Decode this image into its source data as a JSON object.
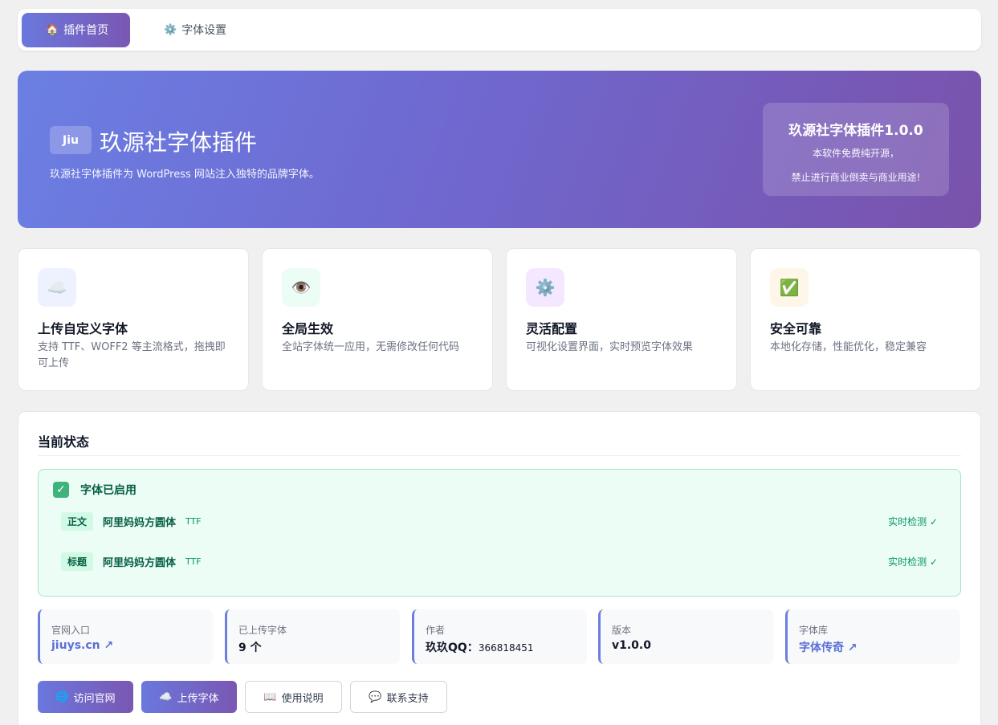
{
  "tabs": [
    {
      "label": "插件首页",
      "icon": "house-icon",
      "active": true
    },
    {
      "label": "字体设置",
      "icon": "gear-icon",
      "active": false
    }
  ],
  "hero": {
    "logo": "Jiu",
    "title": "玖源社字体插件",
    "description": "玖源社字体插件为 WordPress 网站注入独特的品牌字体。",
    "card_title": "玖源社字体插件1.0.0",
    "card_line1": "本软件免费纯开源，",
    "card_line2": "禁止进行商业倒卖与商业用途!"
  },
  "features": [
    {
      "icon": "cloud-icon",
      "title": "上传自定义字体",
      "desc": "支持 TTF、WOFF2 等主流格式，拖拽即可上传"
    },
    {
      "icon": "eye-icon",
      "title": "全局生效",
      "desc": "全站字体统一应用，无需修改任何代码"
    },
    {
      "icon": "gear-icon",
      "title": "灵活配置",
      "desc": "可视化设置界面，实时预览字体效果"
    },
    {
      "icon": "check-icon",
      "title": "安全可靠",
      "desc": "本地化存储，性能优化，稳定兼容"
    }
  ],
  "status": {
    "title": "当前状态",
    "enabled_label": "字体已启用",
    "rows": [
      {
        "tag": "正文",
        "font": "阿里妈妈方圆体",
        "format": "TTF",
        "check": "实时检测 ✓"
      },
      {
        "tag": "标题",
        "font": "阿里妈妈方圆体",
        "format": "TTF",
        "check": "实时检测 ✓"
      }
    ],
    "info": [
      {
        "key": "官网入口",
        "value": "jiuys.cn ↗",
        "link": true
      },
      {
        "key": "已上传字体",
        "value": "9 个",
        "link": false
      },
      {
        "key": "作者",
        "value": "玖玖QQ：",
        "extra": "366818451",
        "link": false
      },
      {
        "key": "版本",
        "value": "v1.0.0",
        "link": false
      },
      {
        "key": "字体库",
        "value": "字体传奇 ↗",
        "link": true
      }
    ]
  },
  "buttons": [
    {
      "label": "访问官网",
      "icon": "globe-icon",
      "style": "primary"
    },
    {
      "label": "上传字体",
      "icon": "cloud-icon",
      "style": "primary"
    },
    {
      "label": "使用说明",
      "icon": "book-icon",
      "style": "outline"
    },
    {
      "label": "联系支持",
      "icon": "chat-icon",
      "style": "outline"
    }
  ],
  "colors": {
    "accent_start": "#6a78dd",
    "accent_end": "#7a57b3",
    "success": "#3fb37c"
  }
}
